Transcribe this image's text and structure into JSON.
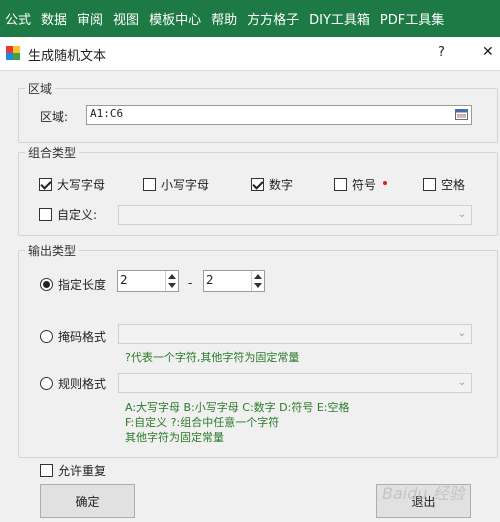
{
  "ribbon": {
    "tabs": [
      "公式",
      "数据",
      "审阅",
      "视图",
      "模板中心",
      "帮助",
      "方方格子",
      "DIY工具箱",
      "PDF工具集"
    ]
  },
  "dialog": {
    "title": "生成随机文本",
    "help": "?",
    "close": "✕"
  },
  "region": {
    "group_label": "区域",
    "field_label": "区域:",
    "value": "A1:C6"
  },
  "combo": {
    "group_label": "组合类型",
    "options": [
      {
        "label": "大写字母",
        "checked": true
      },
      {
        "label": "小写字母",
        "checked": false
      },
      {
        "label": "数字",
        "checked": true
      },
      {
        "label": "符号",
        "checked": false
      },
      {
        "label": "空格",
        "checked": false
      }
    ],
    "custom_label": "自定义:"
  },
  "output": {
    "group_label": "输出类型",
    "fixed_length_label": "指定长度",
    "length_min": "2",
    "length_sep": "-",
    "length_max": "2",
    "mask_label": "掩码格式",
    "mask_hint": "?代表一个字符,其他字符为固定常量",
    "rule_label": "规则格式",
    "rule_hint_line1": "A:大写字母   B:小写字母   C:数字   D:符号   E:空格",
    "rule_hint_line2": "F:自定义      ?:组合中任意一个字符",
    "rule_hint_line3": "其他字符为固定常量"
  },
  "footer": {
    "allow_repeat": "允许重复",
    "ok": "确定",
    "exit": "退出"
  },
  "watermark": "Baidu 经验"
}
